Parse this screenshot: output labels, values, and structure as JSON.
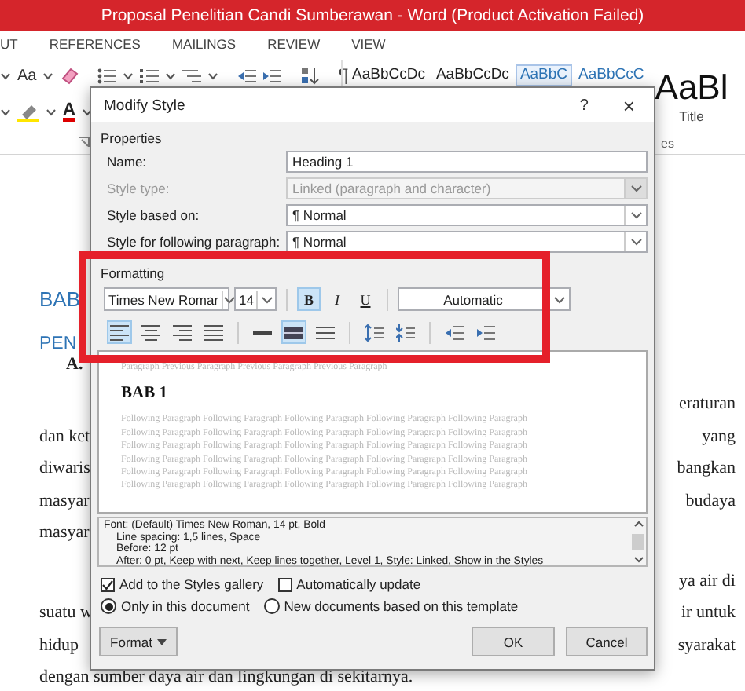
{
  "window": {
    "title": "Proposal Penelitian Candi Sumberawan -  Word (Product Activation Failed)"
  },
  "ribbon": {
    "tabs": [
      "UT",
      "REFERENCES",
      "MAILINGS",
      "REVIEW",
      "VIEW"
    ],
    "change_case": "Aa",
    "pilcrow": "¶",
    "font_color": "A",
    "styles_gallery": [
      {
        "sample": "AaBbCcDc",
        "kind": "normal",
        "selected": false
      },
      {
        "sample": "AaBbCcDc",
        "kind": "normal",
        "selected": false
      },
      {
        "sample": "AaBbC",
        "kind": "heading",
        "selected": true
      },
      {
        "sample": "AaBbCcC",
        "kind": "heading",
        "selected": false
      },
      {
        "sample": "AaBl",
        "name": "Title",
        "kind": "title",
        "selected": false
      }
    ],
    "group_label": "es"
  },
  "document": {
    "headings": [
      {
        "kind": "heading1",
        "text": "BAB"
      },
      {
        "kind": "heading2",
        "text": "PEN"
      },
      {
        "kind": "heading3",
        "text": "A."
      }
    ],
    "paragraphs": [
      {
        "lines": [
          {
            "right": "eraturan"
          },
          {
            "left": "dan ket",
            "right": "yang"
          },
          {
            "left": "diwaris",
            "right": "bangkan"
          },
          {
            "left": "masyar",
            "right": "budaya"
          },
          {
            "left": "masyar"
          }
        ]
      },
      {
        "lines": [
          {
            "right": "ya air di"
          },
          {
            "left": "suatu w",
            "right": "ir untuk"
          },
          {
            "left": "hidup",
            "right": "syarakat"
          },
          {
            "left": "dengan sumber daya air dan lingkungan di sekitarnya."
          }
        ]
      }
    ]
  },
  "dialog": {
    "title": "Modify Style",
    "help": "?",
    "close": "×",
    "properties": {
      "label": "Properties",
      "fields": [
        {
          "label": "Name:",
          "value": "Heading 1",
          "kind": "text",
          "disabled": false
        },
        {
          "label": "Style type:",
          "value": "Linked (paragraph and character)",
          "kind": "dropdown",
          "disabled": true
        },
        {
          "label": "Style based on:",
          "value": "¶ Normal",
          "kind": "dropdown",
          "disabled": false
        },
        {
          "label": "Style for following paragraph:",
          "value": "¶ Normal",
          "kind": "dropdown",
          "disabled": false
        }
      ]
    },
    "formatting": {
      "label": "Formatting",
      "font": "Times New Romar",
      "size": "14",
      "text_styles": [
        {
          "label": "B",
          "kind": "bold",
          "selected": true
        },
        {
          "label": "I",
          "kind": "italic",
          "selected": false
        },
        {
          "label": "U",
          "kind": "underline",
          "selected": false
        }
      ],
      "color_choice": "Automatic",
      "paragraph_buttons": [
        {
          "kind": "align-left",
          "selected": true
        },
        {
          "kind": "align-center",
          "selected": false
        },
        {
          "kind": "align-right",
          "selected": false
        },
        {
          "kind": "justify",
          "selected": false
        },
        {
          "kind": "single-spacing",
          "selected": false
        },
        {
          "kind": "one-half-spacing",
          "selected": true
        },
        {
          "kind": "double-spacing",
          "selected": false
        },
        {
          "kind": "increase-spacing",
          "selected": false
        },
        {
          "kind": "decrease-spacing",
          "selected": false
        },
        {
          "kind": "decrease-indent",
          "selected": false
        },
        {
          "kind": "increase-indent",
          "selected": false
        }
      ]
    },
    "preview": {
      "previous": "Paragraph Previous Paragraph Previous Paragraph Previous Paragraph",
      "sample": "BAB 1",
      "following": [
        "Following Paragraph Following Paragraph Following Paragraph Following Paragraph Following Paragraph",
        "Following Paragraph Following Paragraph Following Paragraph Following Paragraph Following Paragraph",
        "Following Paragraph Following Paragraph Following Paragraph Following Paragraph Following Paragraph",
        "Following Paragraph Following Paragraph Following Paragraph Following Paragraph Following Paragraph",
        "Following Paragraph Following Paragraph Following Paragraph Following Paragraph Following Paragraph",
        "Following Paragraph Following Paragraph Following Paragraph Following Paragraph Following Paragraph"
      ]
    },
    "description": [
      "Font: (Default) Times New Roman, 14 pt, Bold",
      "Line spacing:  1,5 lines, Space",
      "Before:  12 pt",
      "After:  0 pt, Keep with next, Keep lines together, Level 1, Style: Linked, Show in the Styles"
    ],
    "checkboxes": [
      {
        "label": "Add to the Styles gallery",
        "checked": true
      },
      {
        "label": "Automatically update",
        "checked": false
      }
    ],
    "scope": [
      {
        "label": "Only in this document",
        "selected": true
      },
      {
        "label": "New documents based on this template",
        "selected": false
      }
    ],
    "buttons": [
      {
        "label": "Format",
        "kind": "menu"
      },
      {
        "label": "OK",
        "kind": "ok"
      },
      {
        "label": "Cancel",
        "kind": "cancel"
      }
    ]
  }
}
